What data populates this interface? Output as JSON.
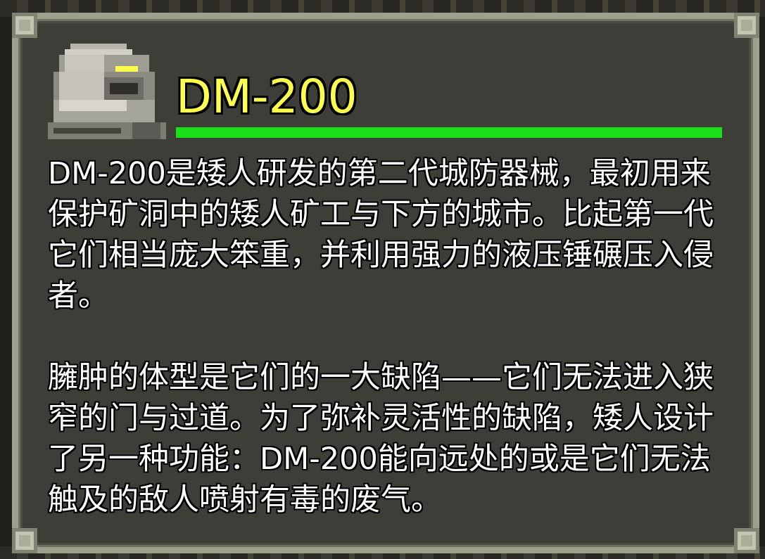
{
  "info_window": {
    "title": "DM-200",
    "health_fraction": 1.0,
    "health_color": "#19e019",
    "title_color": "#ffff4d",
    "sprite_icon": "dm-200-golem-sprite",
    "description": [
      "DM-200是矮人研发的第二代城防器械，最初用来保护矿洞中的矮人矿工与下方的城市。比起第一代它们相当庞大笨重，并利用强力的液压锤碾压入侵者。",
      "臃肿的体型是它们的一大缺陷——它们无法进入狭窄的门与过道。为了弥补灵活性的缺陷，矮人设计了另一种功能：DM-200能向远处的或是它们无法触及的敌人喷射有毒的废气。"
    ]
  }
}
